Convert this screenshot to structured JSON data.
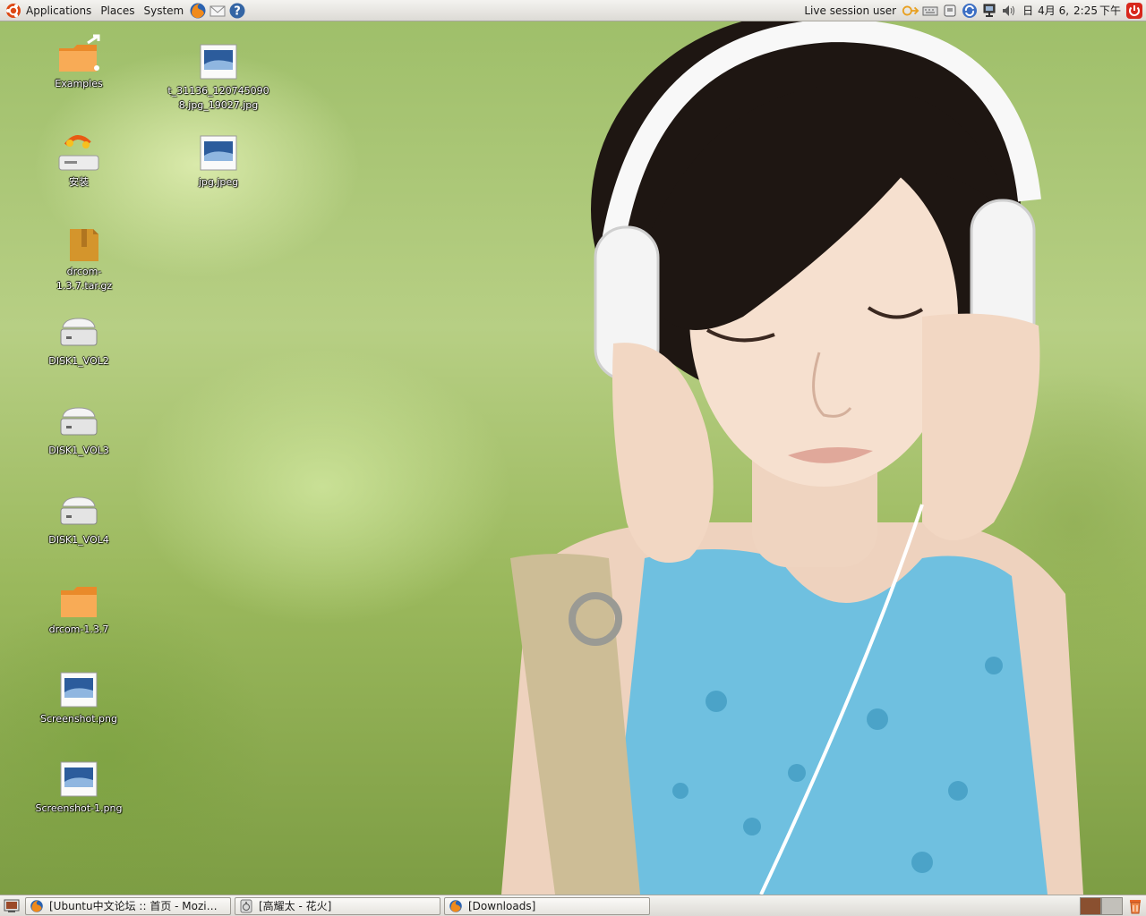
{
  "top_panel": {
    "menus": {
      "applications": "Applications",
      "places": "Places",
      "system": "System"
    },
    "launchers": [
      "firefox-icon",
      "mail-icon",
      "help-icon"
    ],
    "user": "Live session user",
    "clock": {
      "day": "日",
      "date": "4月 6,",
      "time": "2:25",
      "period": "下午"
    },
    "tray_icons": [
      "arrow-icon",
      "keyboard-icon",
      "drive-icon",
      "update-icon",
      "network-icon",
      "volume-icon"
    ],
    "shutdown_icon": "power-icon"
  },
  "desktop_icons": [
    {
      "id": "examples",
      "label": "Examples",
      "icon": "folder-link-icon"
    },
    {
      "id": "install",
      "label": "安装",
      "icon": "installer-icon"
    },
    {
      "id": "drcom-tar",
      "label": "drcom-1.3.7.tar.gz",
      "icon": "archive-icon"
    },
    {
      "id": "disk1-vol2",
      "label": "DISK1_VOL2",
      "icon": "drive-icon"
    },
    {
      "id": "disk1-vol3",
      "label": "DISK1_VOL3",
      "icon": "drive-icon"
    },
    {
      "id": "disk1-vol4",
      "label": "DISK1_VOL4",
      "icon": "drive-icon"
    },
    {
      "id": "drcom-folder",
      "label": "drcom-1.3.7",
      "icon": "folder-icon"
    },
    {
      "id": "screenshot-png",
      "label": "Screenshot.png",
      "icon": "image-icon"
    },
    {
      "id": "screenshot-1-png",
      "label": "Screenshot-1.png",
      "icon": "image-icon"
    },
    {
      "id": "t-jpg",
      "label": "t_31136_1207450908.jpg_19027.jpg",
      "icon": "image-icon"
    },
    {
      "id": "jpg-jpeg",
      "label": "jpg.jpeg",
      "icon": "image-icon"
    }
  ],
  "taskbar": {
    "tasks": [
      {
        "label": "[Ubuntu中文论坛 :: 首页 - Mozi…",
        "icon": "firefox-icon"
      },
      {
        "label": "[高耀太 - 花火]",
        "icon": "audio-player-icon"
      },
      {
        "label": "[Downloads]",
        "icon": "firefox-icon"
      }
    ],
    "workspace_colors": [
      "#8a5030",
      "#c2c0ba"
    ],
    "trash_icon": "trash-icon"
  },
  "colors": {
    "ubuntu_orange": "#dd4814",
    "folder_orange": "#f5a04b",
    "panel_bg": "#e8e6e1"
  }
}
